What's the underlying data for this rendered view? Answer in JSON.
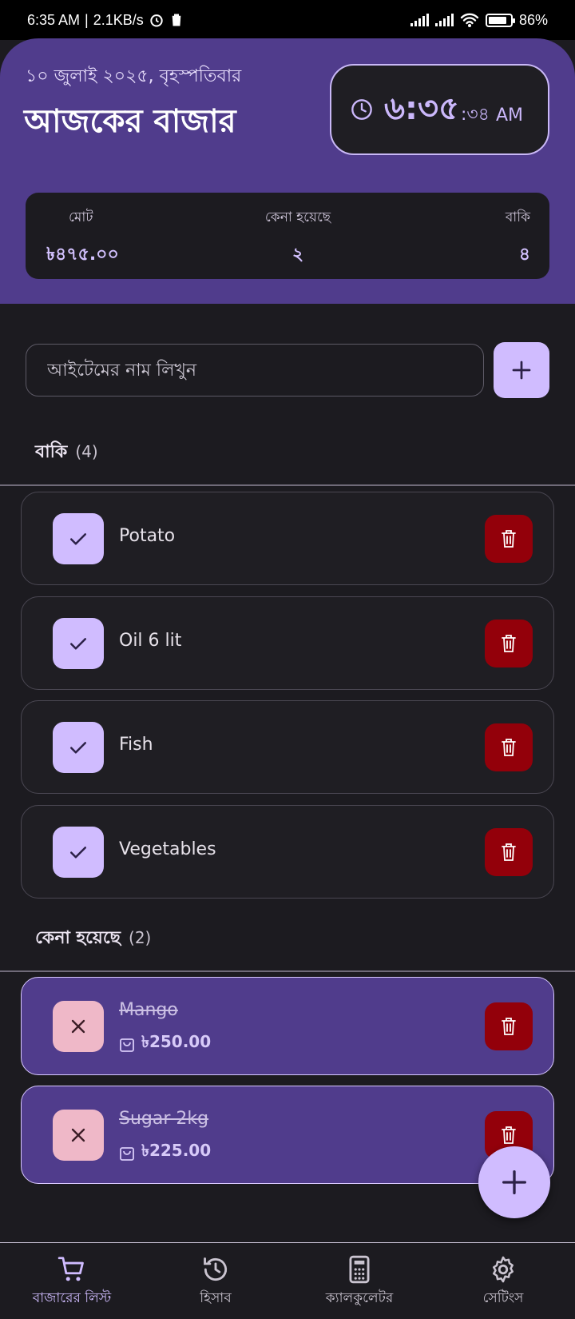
{
  "status_bar": {
    "time": "6:35 AM",
    "net_speed": "2.1KB/s",
    "battery": "86%",
    "icons": [
      "alarm-icon",
      "trash-notification-icon",
      "signal-icon",
      "signal-icon",
      "wifi-icon",
      "battery-icon"
    ]
  },
  "header": {
    "date": "১০ জুলাই ২০২৫, বৃহস্পতিবার",
    "title": "আজকের বাজার",
    "clock": {
      "hm": "৬:৩৫",
      "sec": ":৩৪",
      "ampm": "AM"
    }
  },
  "summary": {
    "total_label": "মোট",
    "total_value": "৳৪৭৫.০০",
    "bought_label": "কেনা হয়েছে",
    "bought_value": "২",
    "remaining_label": "বাকি",
    "remaining_value": "৪"
  },
  "add_item": {
    "placeholder": "আইটেমের নাম লিখুন"
  },
  "pending": {
    "label": "বাকি",
    "count": "(4)",
    "items": [
      {
        "name": "Potato"
      },
      {
        "name": "Oil 6 lit"
      },
      {
        "name": "Fish"
      },
      {
        "name": "Vegetables"
      }
    ]
  },
  "bought": {
    "label": "কেনা হয়েছে",
    "count": "(2)",
    "items": [
      {
        "name": "Mango",
        "price": "৳250.00"
      },
      {
        "name": "Sugar 2kg",
        "price": "৳225.00"
      }
    ]
  },
  "bottom_nav": [
    {
      "label": "বাজারের লিস্ট",
      "icon": "cart-icon",
      "active": true
    },
    {
      "label": "হিসাব",
      "icon": "history-icon",
      "active": false
    },
    {
      "label": "ক্যালকুলেটর",
      "icon": "calculator-icon",
      "active": false
    },
    {
      "label": "সেটিংস",
      "icon": "settings-icon",
      "active": false
    }
  ],
  "colors": {
    "primary": "#d0bcff",
    "header_bg": "#503c8c",
    "surface": "#1c1b20",
    "danger": "#93000a",
    "undo": "#efb8c8"
  }
}
